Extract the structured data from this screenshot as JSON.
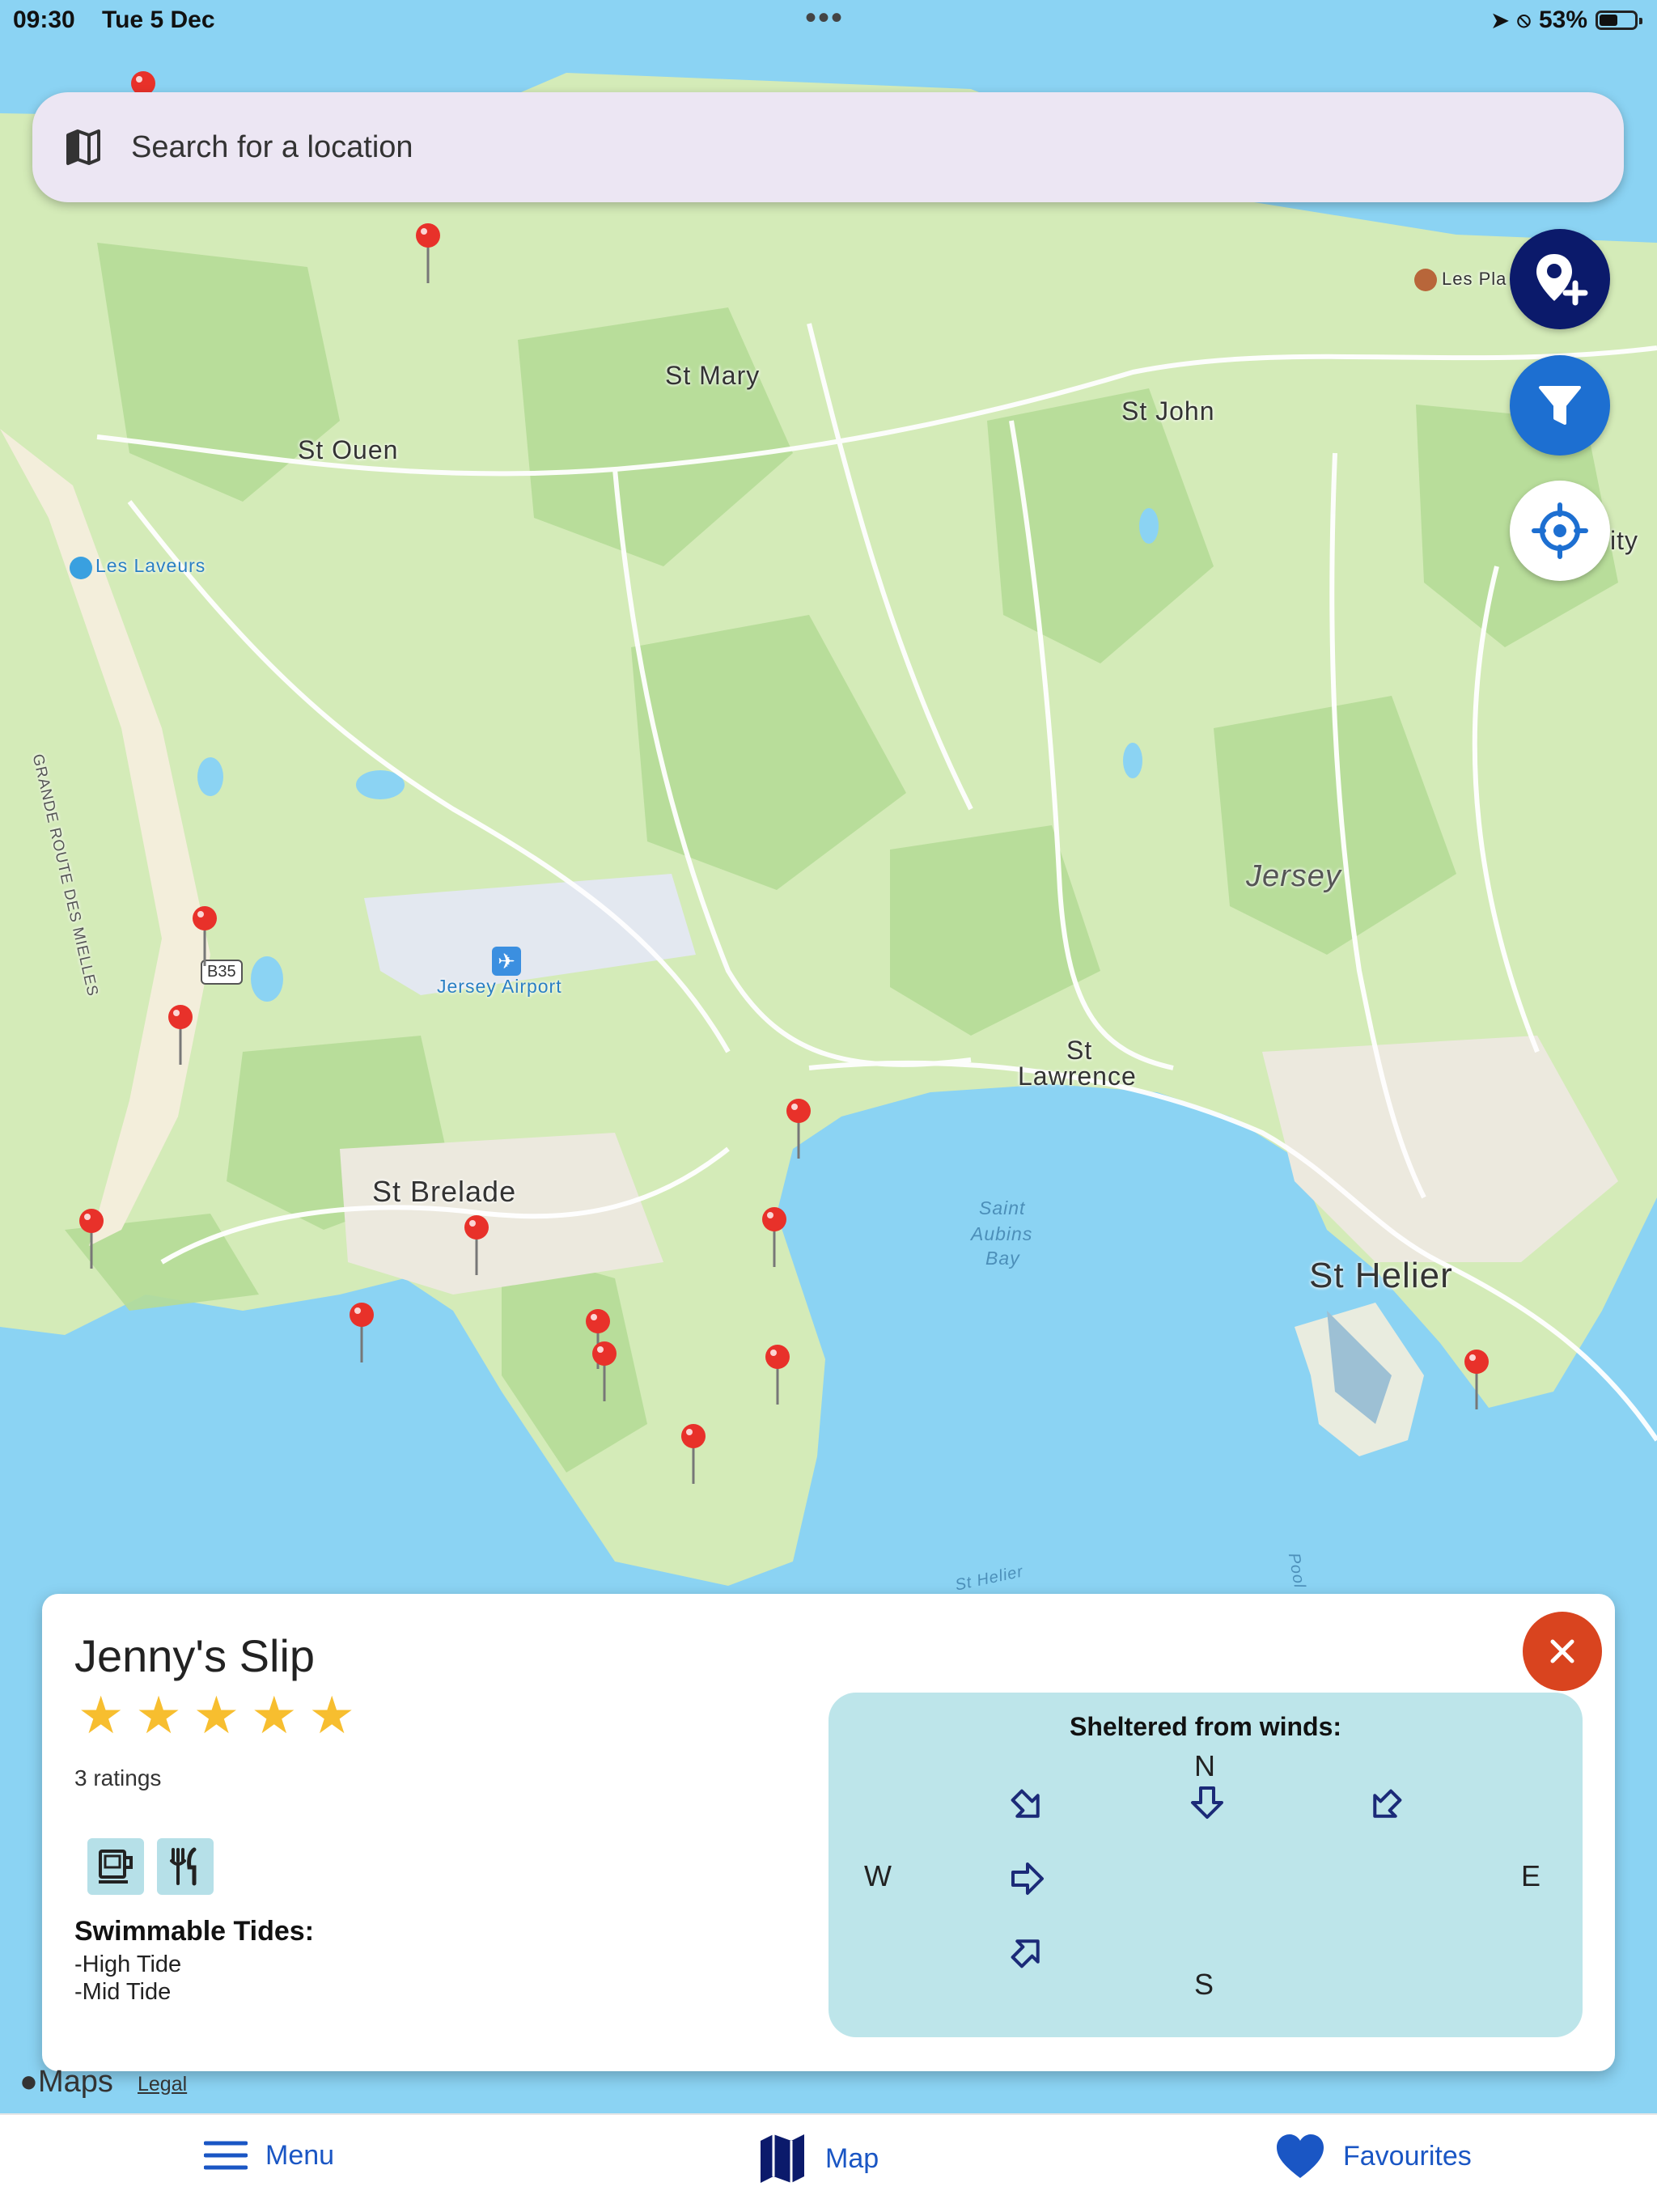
{
  "status_bar": {
    "time": "09:30",
    "date": "Tue 5 Dec",
    "battery": "53%",
    "battery_level": 0.53
  },
  "search": {
    "placeholder": "Search for a location",
    "icon": "map-icon"
  },
  "fabs": {
    "add_location": "add-location-icon",
    "filter": "filter-icon",
    "locate": "crosshair-icon"
  },
  "map_labels": {
    "st_mary": "St Mary",
    "st_john": "St John",
    "st_ouen": "St Ouen",
    "les_laveurs": "Les Laveurs",
    "grande_route": "GRANDE ROUTE DES MIELLES",
    "b35": "B35",
    "jersey_airport": "Jersey Airport",
    "jersey": "Jersey",
    "st_lawrence_1": "St",
    "st_lawrence_2": "Lawrence",
    "st_brelade": "St Brelade",
    "saint_aubins_1": "Saint",
    "saint_aubins_2": "Aubins",
    "saint_aubins_3": "Bay",
    "st_helier": "St Helier",
    "les_pla": "Les Pla",
    "trinity_partial": "ity",
    "st_helier_water": "St Helier",
    "pool": "Pool"
  },
  "spot_card": {
    "title": "Jenny's Slip",
    "rating_stars": 5,
    "ratings_text": "3 ratings",
    "amenities": [
      "cafe-icon",
      "restaurant-icon"
    ],
    "tides_heading": "Swimmable Tides:",
    "tides": [
      "-High Tide",
      "-Mid Tide"
    ],
    "close_icon": "close-icon",
    "wind": {
      "heading": "Sheltered from winds:",
      "n": "N",
      "s": "S",
      "e": "E",
      "w": "W",
      "sheltered": [
        "N",
        "NE",
        "NW",
        "W",
        "SW"
      ]
    }
  },
  "footer": {
    "maps_logo": "Maps",
    "legal": "Legal"
  },
  "tabbar": {
    "menu": "Menu",
    "map": "Map",
    "favourites": "Favourites"
  },
  "colors": {
    "water": "#8bd3f3",
    "land": "#d4ebb8",
    "dark_green": "#b5dc97",
    "pin": "#e8312a",
    "navy": "#0b1a6b",
    "blue": "#1d6fd1",
    "close": "#d9441f",
    "star": "#f7be2f",
    "wind_panel": "#bde5ea"
  }
}
